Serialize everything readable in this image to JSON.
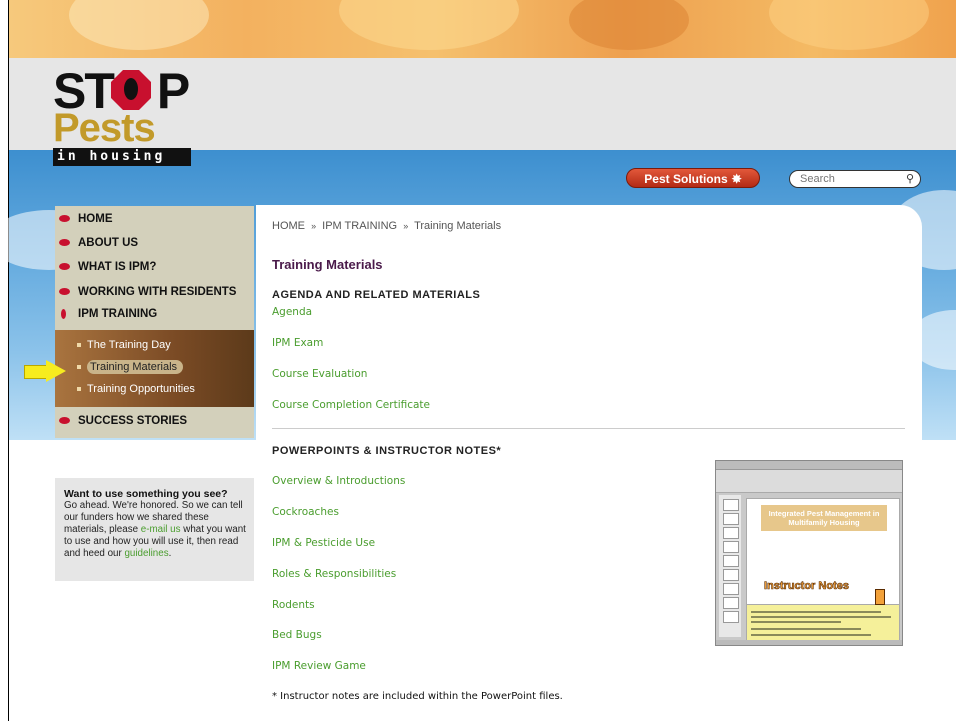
{
  "brand": {
    "logo_line1": "ST",
    "logo_line1b": "P",
    "logo_line2": "Pests",
    "logo_line3": "in housing"
  },
  "header": {
    "pest_solutions_label": "Pest Solutions",
    "search_placeholder": "Search"
  },
  "sidebar": {
    "items": [
      {
        "label": "HOME"
      },
      {
        "label": "ABOUT US"
      },
      {
        "label": "WHAT IS IPM?"
      },
      {
        "label": "WORKING WITH RESIDENTS"
      },
      {
        "label": "IPM TRAINING"
      },
      {
        "label": "SUCCESS STORIES"
      }
    ],
    "subitems": [
      {
        "label": "The Training Day"
      },
      {
        "label": "Training Materials"
      },
      {
        "label": "Training Opportunities"
      }
    ]
  },
  "promo": {
    "heading": "Want to use something you see?",
    "text1": "Go ahead. We're honored. So we can tell our funders how we shared these materials, please ",
    "email_link": "e-mail us",
    "text2": " what you want to use and how you will use it, then read and heed our ",
    "guidelines_link": "guidelines",
    "text3": "."
  },
  "breadcrumb": {
    "home": "HOME",
    "section": "IPM TRAINING",
    "current": "Training Materials",
    "sep": "»"
  },
  "main": {
    "title": "Training Materials",
    "section1_heading": "AGENDA AND RELATED MATERIALS",
    "section1_links": [
      "Agenda",
      "IPM Exam",
      "Course Evaluation",
      "Course Completion Certificate"
    ],
    "section2_heading": "POWERPOINTS & INSTRUCTOR NOTES*",
    "section2_links": [
      "Overview & Introductions",
      "Cockroaches",
      "IPM & Pesticide Use",
      "Roles & Responsibilities",
      "Rodents",
      "Bed Bugs",
      "IPM Review Game"
    ],
    "footnote": "* Instructor notes are included within the PowerPoint files."
  },
  "thumbnail": {
    "slide_title": "Integrated Pest Management in Multifamily Housing",
    "callout": "Instructor Notes"
  },
  "colors": {
    "link": "#4a9d2e",
    "title": "#4a1a4a",
    "nav_bg": "#d3d0bb",
    "bullet": "#c8102e"
  }
}
